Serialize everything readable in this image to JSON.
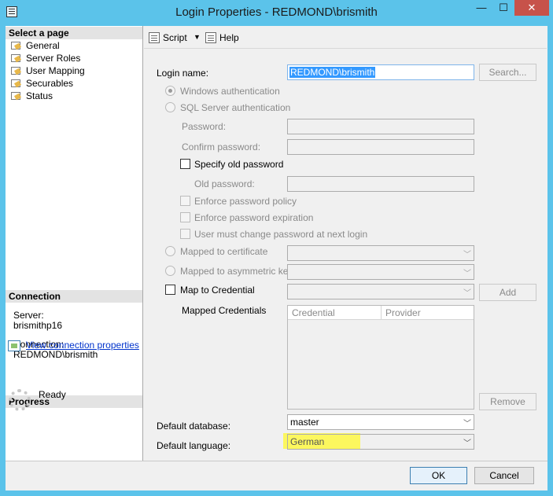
{
  "window": {
    "title": "Login Properties - REDMOND\\brismith",
    "minimize_glyph": "—",
    "maximize_glyph": "☐",
    "close_glyph": "✕"
  },
  "left_pane": {
    "select_page_header": "Select a page",
    "pages": [
      {
        "label": "General",
        "icon": "wrench-page-icon"
      },
      {
        "label": "Server Roles",
        "icon": "wrench-page-icon"
      },
      {
        "label": "User Mapping",
        "icon": "wrench-page-icon"
      },
      {
        "label": "Securables",
        "icon": "wrench-page-icon"
      },
      {
        "label": "Status",
        "icon": "wrench-page-icon"
      }
    ],
    "connection_header": "Connection",
    "server_label": "Server:",
    "server_value": "brismithp16",
    "connection_label": "Connection:",
    "connection_value": "REDMOND\\brismith",
    "view_connection_link": "View connection properties",
    "progress_header": "Progress",
    "progress_status": "Ready"
  },
  "toolbar": {
    "script_label": "Script",
    "help_label": "Help"
  },
  "form": {
    "login_name_label": "Login name:",
    "login_name_value": "REDMOND\\brismith",
    "search_button": "Search...",
    "windows_auth": "Windows authentication",
    "sql_auth": "SQL Server authentication",
    "password_label": "Password:",
    "confirm_password_label": "Confirm password:",
    "specify_old_password": "Specify old password",
    "old_password_label": "Old password:",
    "enforce_policy": "Enforce password policy",
    "enforce_expiration": "Enforce password expiration",
    "must_change": "User must change password at next login",
    "mapped_certificate": "Mapped to certificate",
    "mapped_asym_key": "Mapped to asymmetric key",
    "map_to_credential": "Map to Credential",
    "add_button": "Add",
    "mapped_credentials_label": "Mapped Credentials",
    "grid_columns": [
      "Credential",
      "Provider"
    ],
    "remove_button": "Remove",
    "default_database_label": "Default database:",
    "default_database_value": "master",
    "default_language_label": "Default language:",
    "default_language_value": "German"
  },
  "footer": {
    "ok_button": "OK",
    "cancel_button": "Cancel"
  },
  "colors": {
    "title_bar": "#5bc3ea",
    "close_button": "#c7524a",
    "highlight": "#fff93a",
    "selection": "#3399ff"
  }
}
